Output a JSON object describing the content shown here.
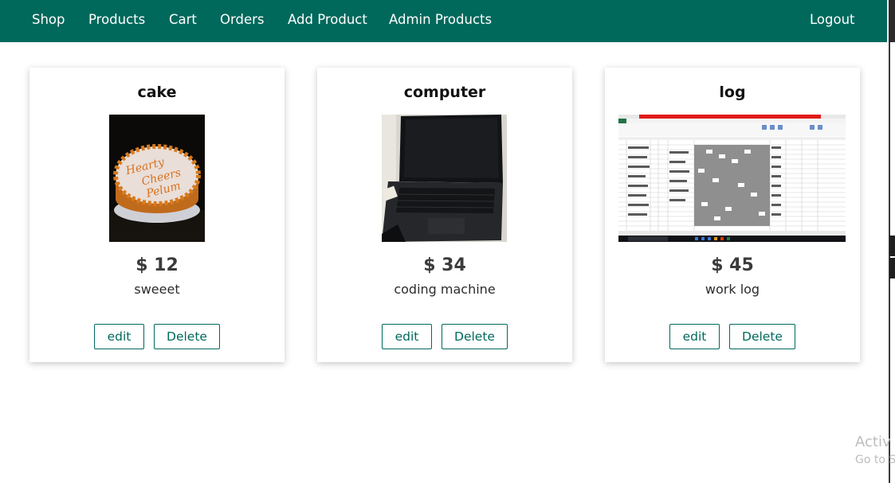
{
  "nav": {
    "shop": "Shop",
    "products": "Products",
    "cart": "Cart",
    "orders": "Orders",
    "add_product": "Add Product",
    "admin_products": "Admin Products",
    "logout": "Logout"
  },
  "products": [
    {
      "title": "cake",
      "price": "$ 12",
      "description": "sweeet",
      "edit_label": "edit",
      "delete_label": "Delete"
    },
    {
      "title": "computer",
      "price": "$ 34",
      "description": "coding machine",
      "edit_label": "edit",
      "delete_label": "Delete"
    },
    {
      "title": "log",
      "price": "$ 45",
      "description": "work log",
      "edit_label": "edit",
      "delete_label": "Delete"
    }
  ],
  "watermark": {
    "line1": "Activ",
    "line2": "Go to S"
  },
  "colors": {
    "primary": "#00695c",
    "text": "#3b3b3b"
  }
}
